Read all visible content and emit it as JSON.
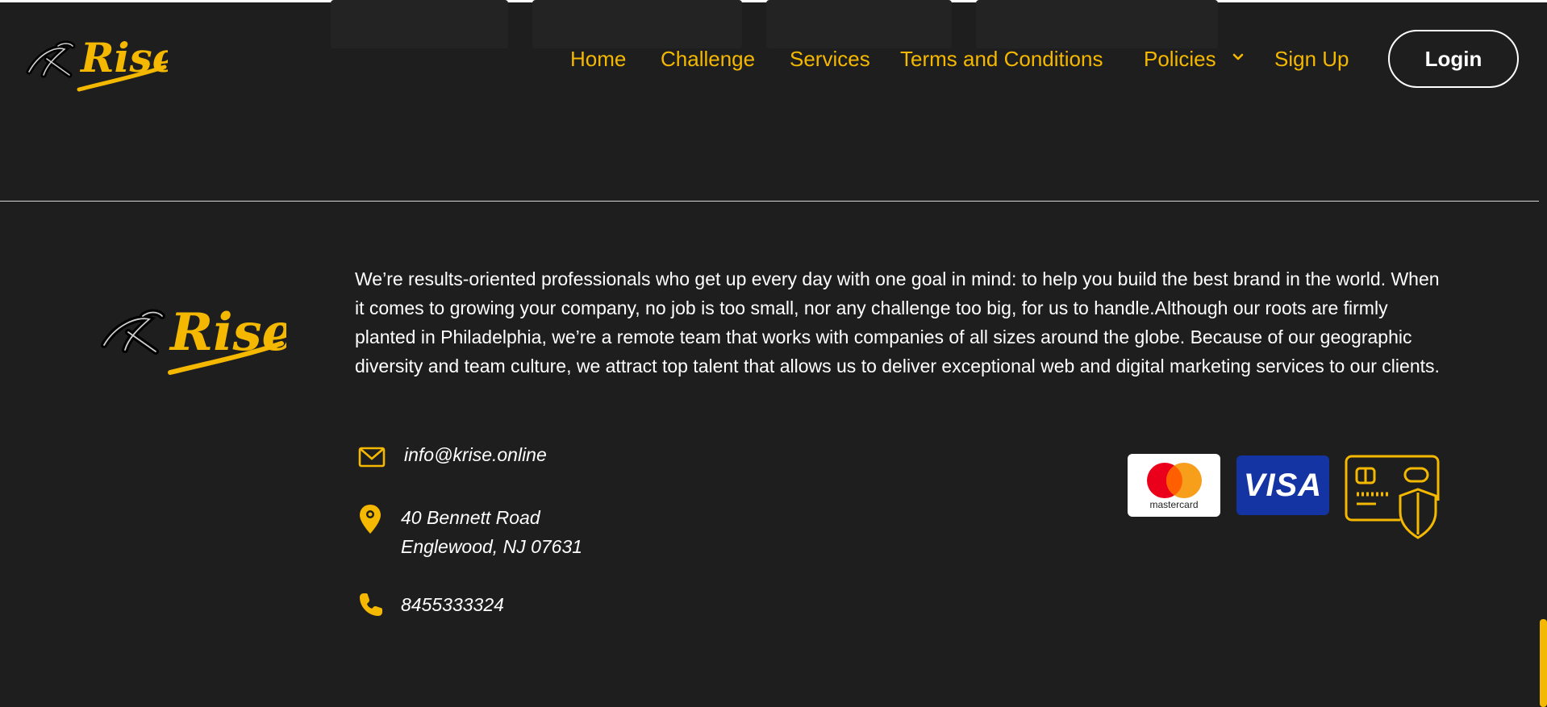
{
  "brand": {
    "logo_text": "Rise",
    "accent_color": "#f5b800",
    "background_color": "#1e1e1e"
  },
  "nav": {
    "items": [
      {
        "label": "Home"
      },
      {
        "label": "Challenge"
      },
      {
        "label": "Services"
      },
      {
        "label": "Terms and Conditions"
      },
      {
        "label": "Policies",
        "icon": "chevron-down-icon"
      },
      {
        "label": "Sign Up"
      }
    ],
    "login_label": "Login"
  },
  "footer": {
    "about": "We’re results-oriented professionals who get up every day with one goal in mind: to help you build the best brand in the world. When it comes to growing your company, no job is too small, nor any challenge too big, for us to handle.Although our roots are firmly planted in Philadelphia, we’re a remote team that works with companies of all sizes around the globe. Because of our geographic diversity and team culture, we attract top talent that allows us to deliver exceptional web and digital marketing services to our clients.",
    "email": "info@krise.online",
    "address_line1": "40 Bennett Road",
    "address_line2": "Englewood, NJ 07631",
    "phone": "8455333324",
    "payment": {
      "mastercard_label": "mastercard",
      "visa_label": "VISA",
      "secure_icon": "secure-card-shield-icon"
    }
  }
}
